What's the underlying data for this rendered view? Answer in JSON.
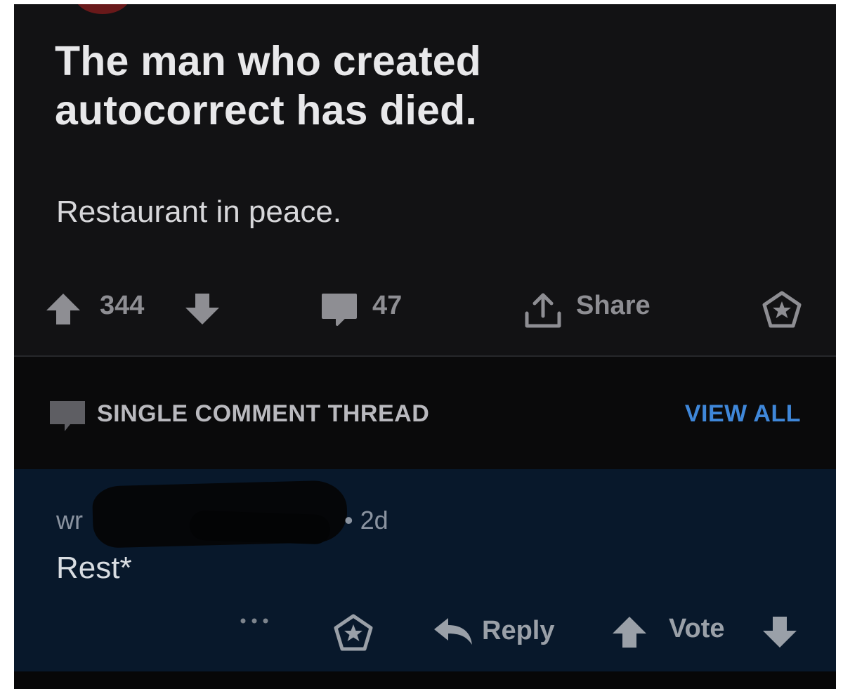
{
  "post": {
    "title": "The man who created autocorrect has died.",
    "body": "Restaurant in peace.",
    "score": "344",
    "comment_count": "47",
    "share_label": "Share"
  },
  "thread": {
    "label": "SINGLE COMMENT THREAD",
    "view_all_label": "VIEW ALL"
  },
  "comment": {
    "username": "wr",
    "age": "• 2d",
    "text": "Rest*",
    "reply_label": "Reply",
    "vote_label": "Vote",
    "more_label": "..."
  },
  "colors": {
    "background": "#121214",
    "comment_background": "#08182b",
    "accent": "#3f87d9"
  },
  "icons": {
    "upvote": "arrow-up-icon",
    "downvote": "arrow-down-icon",
    "comments": "speech-bubble-icon",
    "share": "share-upload-icon",
    "award": "award-star-icon",
    "reply": "reply-arrow-icon",
    "more": "more-dots-icon"
  }
}
